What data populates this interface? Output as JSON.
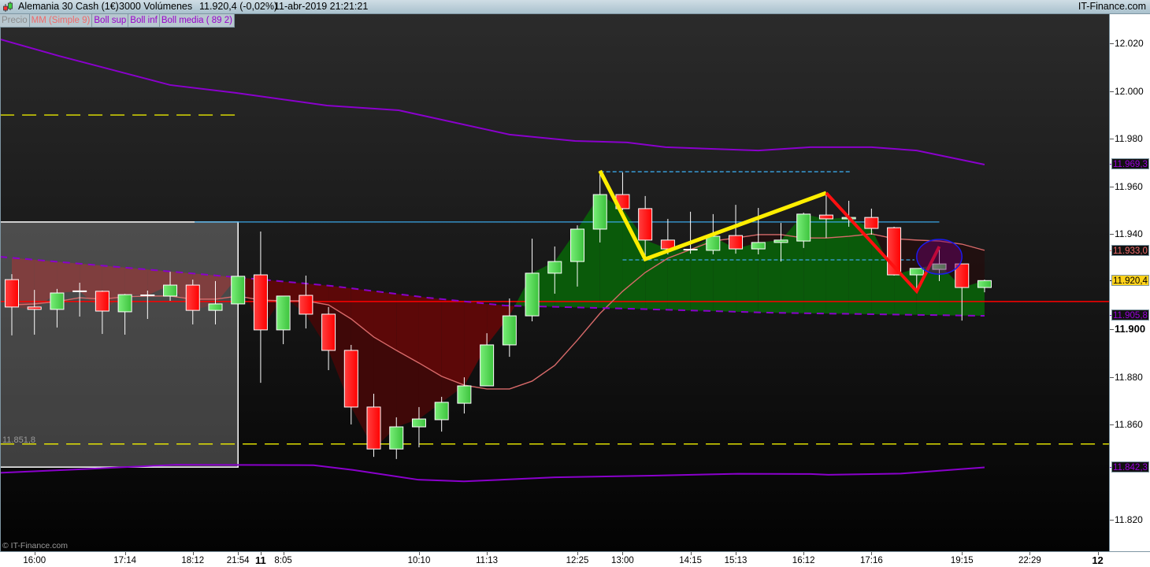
{
  "header": {
    "instrument": "Alemania 30 Cash (1€)",
    "volume": "3000 Volúmenes",
    "last_price": "11.920,4 (-0,02%)",
    "datetime": "11-abr-2019 21:21:21",
    "brand": "IT-Finance.com",
    "icon": "candlestick-icon"
  },
  "legend": [
    {
      "label": "Precio",
      "color": "#8c8c8c"
    },
    {
      "label": "MM (Simple 9)",
      "color": "#f06a6a"
    },
    {
      "label": "Boll sup",
      "color": "#9a00cc"
    },
    {
      "label": "Boll inf",
      "color": "#9a00cc"
    },
    {
      "label": "Boll media ( 89 2)",
      "color": "#9a00cc"
    }
  ],
  "copyright": "© IT-Finance.com",
  "colors": {
    "up": "#55dd55",
    "down": "#ff1a1a",
    "boll": "#8a00cc",
    "mm": "#d86a6a",
    "hline": "#ff0000",
    "blue": "#3aa6e6",
    "fill_up": "#0a5a0a",
    "fill_down": "#5c0808"
  },
  "chart_data": {
    "type": "candlestick",
    "ylim": [
      11806.8,
      12032.2
    ],
    "grid": false,
    "y_ticks": [
      {
        "value": 12020,
        "label": "12.020"
      },
      {
        "value": 12000,
        "label": "12.000"
      },
      {
        "value": 11980,
        "label": "11.980"
      },
      {
        "value": 11960,
        "label": "11.960"
      },
      {
        "value": 11940,
        "label": "11.940"
      },
      {
        "value": 11900,
        "label": "11.900",
        "bold": true
      },
      {
        "value": 11880,
        "label": "11.880"
      },
      {
        "value": 11860,
        "label": "11.860"
      },
      {
        "value": 11820,
        "label": "11.820"
      }
    ],
    "price_badges": [
      {
        "value": 11969.3,
        "label": "11.969,3",
        "color": "#9a00dd",
        "bg": "#111111"
      },
      {
        "value": 11933.0,
        "label": "11.933,0",
        "color": "#f06a6a",
        "bg": "#111111"
      },
      {
        "value": 11920.4,
        "label": "11.920,4",
        "color": "#000000",
        "bg": "#ffd21a"
      },
      {
        "value": 11905.8,
        "label": "11.905,8",
        "color": "#9a00dd",
        "bg": "#111111"
      },
      {
        "value": 11842.3,
        "label": "11.842,3",
        "color": "#9a00dd",
        "bg": "#111111"
      }
    ],
    "x_labels": [
      {
        "bar": 1,
        "label": "16:00"
      },
      {
        "bar": 5,
        "label": "17:14"
      },
      {
        "bar": 8,
        "label": "18:12"
      },
      {
        "bar": 10,
        "label": "21:54"
      },
      {
        "bar": 11,
        "label": "11",
        "bold": true
      },
      {
        "bar": 12,
        "label": "8:05"
      },
      {
        "bar": 18,
        "label": "10:10"
      },
      {
        "bar": 21,
        "label": "11:13"
      },
      {
        "bar": 25,
        "label": "12:25"
      },
      {
        "bar": 27,
        "label": "13:00"
      },
      {
        "bar": 30,
        "label": "14:15"
      },
      {
        "bar": 32,
        "label": "15:13"
      },
      {
        "bar": 35,
        "label": "16:12"
      },
      {
        "bar": 38,
        "label": "17:16"
      },
      {
        "bar": 42,
        "label": "19:15"
      },
      {
        "bar": 45,
        "label": "22:29"
      },
      {
        "bar": 48,
        "label": "12",
        "bold": true
      }
    ],
    "candles": [
      {
        "o": 11920.8,
        "h": 11923.1,
        "l": 11897.4,
        "c": 11909.3
      },
      {
        "o": 11909.3,
        "h": 11916.5,
        "l": 11897.7,
        "c": 11908.3
      },
      {
        "o": 11908.3,
        "h": 11916.9,
        "l": 11900.7,
        "c": 11915.2
      },
      {
        "o": 11915.9,
        "h": 11919.5,
        "l": 11905.3,
        "c": 11915.9
      },
      {
        "o": 11915.9,
        "h": 11916.2,
        "l": 11898.0,
        "c": 11907.6
      },
      {
        "o": 11907.3,
        "h": 11914.8,
        "l": 11897.7,
        "c": 11914.5
      },
      {
        "o": 11914.2,
        "h": 11916.2,
        "l": 11904.3,
        "c": 11914.2
      },
      {
        "o": 11913.9,
        "h": 11924.1,
        "l": 11911.9,
        "c": 11918.5
      },
      {
        "o": 11918.5,
        "h": 11920.8,
        "l": 11902.0,
        "c": 11907.9
      },
      {
        "o": 11907.9,
        "h": 11920.2,
        "l": 11902.0,
        "c": 11910.6
      },
      {
        "o": 11910.6,
        "h": 11922.2,
        "l": 11909.9,
        "c": 11922.2
      },
      {
        "o": 11922.8,
        "h": 11941.0,
        "l": 11877.5,
        "c": 11899.7
      },
      {
        "o": 11899.7,
        "h": 11913.9,
        "l": 11893.7,
        "c": 11913.9
      },
      {
        "o": 11914.2,
        "h": 11922.5,
        "l": 11900.3,
        "c": 11906.3
      },
      {
        "o": 11906.3,
        "h": 11909.3,
        "l": 11882.8,
        "c": 11891.1
      },
      {
        "o": 11891.1,
        "h": 11893.4,
        "l": 11860.0,
        "c": 11867.3
      },
      {
        "o": 11867.3,
        "h": 11872.9,
        "l": 11846.4,
        "c": 11849.7
      },
      {
        "o": 11849.7,
        "h": 11863.0,
        "l": 11845.5,
        "c": 11859.0
      },
      {
        "o": 11859.0,
        "h": 11867.3,
        "l": 11850.4,
        "c": 11862.3
      },
      {
        "o": 11862.0,
        "h": 11871.6,
        "l": 11857.0,
        "c": 11869.3
      },
      {
        "o": 11868.9,
        "h": 11879.8,
        "l": 11864.6,
        "c": 11876.2
      },
      {
        "o": 11876.2,
        "h": 11898.3,
        "l": 11876.2,
        "c": 11893.4
      },
      {
        "o": 11893.4,
        "h": 11912.9,
        "l": 11888.4,
        "c": 11905.6
      },
      {
        "o": 11905.6,
        "h": 11938.0,
        "l": 11903.3,
        "c": 11923.5
      },
      {
        "o": 11923.5,
        "h": 11934.7,
        "l": 11914.9,
        "c": 11928.4
      },
      {
        "o": 11928.4,
        "h": 11943.6,
        "l": 11917.9,
        "c": 11942.0
      },
      {
        "o": 11942.0,
        "h": 11966.5,
        "l": 11936.4,
        "c": 11956.5
      },
      {
        "o": 11956.5,
        "h": 11965.8,
        "l": 11950.0,
        "c": 11950.6
      },
      {
        "o": 11950.6,
        "h": 11955.9,
        "l": 11929.1,
        "c": 11937.4
      },
      {
        "o": 11937.4,
        "h": 11946.3,
        "l": 11931.4,
        "c": 11933.7
      },
      {
        "o": 11933.4,
        "h": 11949.3,
        "l": 11931.7,
        "c": 11933.4
      },
      {
        "o": 11933.1,
        "h": 11948.3,
        "l": 11931.4,
        "c": 11939.0
      },
      {
        "o": 11939.3,
        "h": 11952.2,
        "l": 11931.7,
        "c": 11933.7
      },
      {
        "o": 11933.7,
        "h": 11950.9,
        "l": 11931.4,
        "c": 11936.4
      },
      {
        "o": 11936.4,
        "h": 11944.6,
        "l": 11928.4,
        "c": 11937.4
      },
      {
        "o": 11937.0,
        "h": 11948.9,
        "l": 11934.1,
        "c": 11948.3
      },
      {
        "o": 11947.9,
        "h": 11956.5,
        "l": 11938.3,
        "c": 11946.3
      },
      {
        "o": 11946.3,
        "h": 11953.9,
        "l": 11943.0,
        "c": 11946.9
      },
      {
        "o": 11946.9,
        "h": 11950.6,
        "l": 11939.7,
        "c": 11942.3
      },
      {
        "o": 11942.6,
        "h": 11943.0,
        "l": 11922.5,
        "c": 11922.8
      },
      {
        "o": 11922.8,
        "h": 11925.5,
        "l": 11915.5,
        "c": 11925.5
      },
      {
        "o": 11925.1,
        "h": 11933.4,
        "l": 11920.2,
        "c": 11927.4
      },
      {
        "o": 11927.4,
        "h": 11927.4,
        "l": 11903.6,
        "c": 11917.5
      },
      {
        "o": 11917.5,
        "h": 11920.8,
        "l": 11915.5,
        "c": 11920.4
      }
    ],
    "series": [
      {
        "name": "MM (Simple 9)",
        "key": "mm",
        "values": [
          11910.2,
          11910.6,
          11911.6,
          11913.2,
          11912.6,
          11913.6,
          11913.9,
          11913.9,
          11912.6,
          11912.6,
          11913.9,
          11912.2,
          11911.9,
          11911.9,
          11910.2,
          11904.3,
          11896.7,
          11891.1,
          11885.8,
          11880.2,
          11876.5,
          11874.9,
          11874.9,
          11878.2,
          11884.8,
          11895.4,
          11906.6,
          11915.9,
          11923.8,
          11929.8,
          11933.4,
          11937.0,
          11938.3,
          11939.7,
          11939.7,
          11938.3,
          11938.3,
          11939.0,
          11940.0,
          11938.0,
          11937.4,
          11937.0,
          11935.7,
          11933.1
        ]
      },
      {
        "name": "Boll sup",
        "key": "boll_sup",
        "points": [
          [
            -0.52,
            12021.7
          ],
          [
            2.09,
            12014.7
          ],
          [
            7.0,
            12002.5
          ],
          [
            9.89,
            11999.2
          ],
          [
            13.93,
            11993.9
          ],
          [
            17.1,
            11991.9
          ],
          [
            22.0,
            11981.7
          ],
          [
            24.9,
            11979.0
          ],
          [
            27.2,
            11978.4
          ],
          [
            28.9,
            11976.4
          ],
          [
            33.0,
            11975.0
          ],
          [
            35.3,
            11976.4
          ],
          [
            38.0,
            11976.4
          ],
          [
            40.0,
            11975.0
          ],
          [
            43.0,
            11969.1
          ]
        ]
      },
      {
        "name": "Boll inf",
        "key": "boll_inf",
        "points": [
          [
            -0.52,
            11839.7
          ],
          [
            3.24,
            11841.3
          ],
          [
            7.28,
            11843.1
          ],
          [
            13.34,
            11842.9
          ],
          [
            15.08,
            11840.9
          ],
          [
            17.97,
            11836.8
          ],
          [
            19.99,
            11836.1
          ],
          [
            24.0,
            11837.8
          ],
          [
            28.3,
            11838.5
          ],
          [
            32.1,
            11839.3
          ],
          [
            35.3,
            11839.2
          ],
          [
            36.1,
            11838.9
          ],
          [
            39.3,
            11839.4
          ],
          [
            43.0,
            11842.0
          ]
        ]
      },
      {
        "name": "Boll media ( 89 2)",
        "key": "boll_media",
        "points": [
          [
            -0.52,
            11930.4
          ],
          [
            9.92,
            11921.8
          ],
          [
            14.1,
            11918.2
          ],
          [
            18.4,
            11913.2
          ],
          [
            21.8,
            11909.9
          ],
          [
            27.3,
            11908.6
          ],
          [
            33.6,
            11906.9
          ],
          [
            43.0,
            11905.6
          ]
        ]
      }
    ],
    "horizontal_lines": [
      {
        "price": 11911.6,
        "from": -0.52,
        "to": 48.5,
        "color": "#ff0000",
        "style": "solid"
      },
      {
        "price": 11851.8,
        "from": -0.52,
        "to": 48.5,
        "color": "#f0f000",
        "style": "dashed",
        "label": "11.851,8"
      },
      {
        "price": 11989.9,
        "from": -0.52,
        "to": 9.92,
        "color": "#e6e600",
        "style": "dashed"
      },
      {
        "price": 11945.0,
        "from": 8.08,
        "to": 41.0,
        "color": "#3aa6e6",
        "style": "solid"
      },
      {
        "price": 11966.1,
        "from": 26.0,
        "to": 37.1,
        "color": "#3aa6e6",
        "style": "dotted"
      },
      {
        "price": 11929.1,
        "from": 27.0,
        "to": 39.9,
        "color": "#3aa6e6",
        "style": "dotted"
      }
    ],
    "zone_box": {
      "from": -0.52,
      "to": 10.0,
      "top": 11945.0,
      "bottom": 11842.1
    },
    "drawings": [
      {
        "kind": "polyline",
        "color": "#ffee00",
        "points": [
          [
            26.0,
            11966.5
          ],
          [
            28.0,
            11929.4
          ],
          [
            36.0,
            11957.2
          ]
        ]
      },
      {
        "kind": "polyline",
        "color": "#ff1010",
        "points": [
          [
            36.0,
            11957.2
          ],
          [
            40.0,
            11915.9
          ],
          [
            41.0,
            11934.7
          ]
        ]
      },
      {
        "kind": "ellipse",
        "color": "#1a1aee",
        "center": [
          41.0,
          11930.4
        ],
        "bar_radius": 1.0,
        "price_radius": 7.3
      }
    ]
  }
}
